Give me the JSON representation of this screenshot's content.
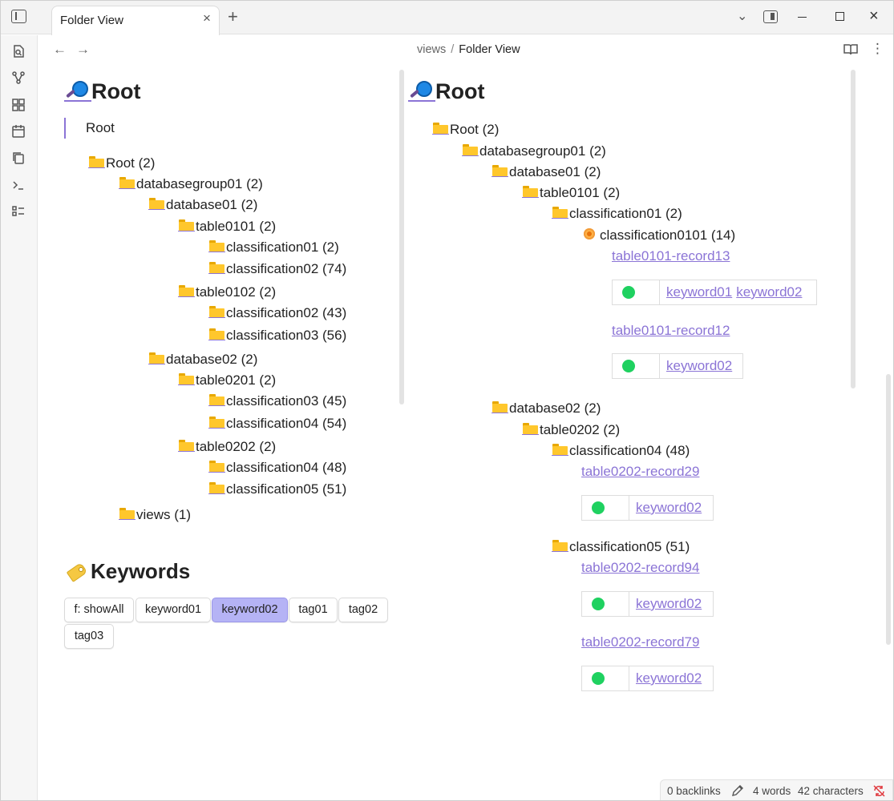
{
  "window": {
    "tab_title": "Folder View",
    "breadcrumb_parent": "views",
    "breadcrumb_sep": "/",
    "breadcrumb_current": "Folder View"
  },
  "left": {
    "heading": "Root",
    "blockquote": "Root",
    "tree": [
      {
        "label": "Root (2)"
      },
      {
        "label": "databasegroup01 (2)"
      },
      {
        "label": "database01 (2)"
      },
      {
        "label": "table0101 (2)"
      },
      {
        "label": "classification01 (2)"
      },
      {
        "label": "classification02 (74)"
      },
      {
        "label": "table0102 (2)"
      },
      {
        "label": "classification02 (43)"
      },
      {
        "label": "classification03 (56)"
      },
      {
        "label": "database02 (2)"
      },
      {
        "label": "table0201 (2)"
      },
      {
        "label": "classification03 (45)"
      },
      {
        "label": "classification04 (54)"
      },
      {
        "label": "table0202 (2)"
      },
      {
        "label": "classification04 (48)"
      },
      {
        "label": "classification05 (51)"
      },
      {
        "label": "views (1)"
      }
    ],
    "keywords_heading": "Keywords",
    "keyword_buttons": [
      "f: showAll",
      "keyword01",
      "keyword02",
      "tag01",
      "tag02",
      "tag03"
    ],
    "active_keyword": "keyword02"
  },
  "right": {
    "heading": "Root",
    "tree": [
      {
        "label": "Root (2)"
      },
      {
        "label": "databasegroup01 (2)"
      },
      {
        "label": "database01 (2)"
      },
      {
        "label": "table0101 (2)"
      },
      {
        "label": "classification01 (2)"
      },
      {
        "label": "classification0101 (14)"
      },
      {
        "label": "database02 (2)"
      },
      {
        "label": "table0202 (2)"
      },
      {
        "label": "classification04 (48)"
      },
      {
        "label": "classification05 (51)"
      }
    ],
    "records": [
      {
        "name": "table0101-record13",
        "keywords": [
          "keyword01",
          "keyword02"
        ]
      },
      {
        "name": "table0101-record12",
        "keywords": [
          "keyword02"
        ]
      },
      {
        "name": "table0202-record29",
        "keywords": [
          "keyword02"
        ]
      },
      {
        "name": "table0202-record94",
        "keywords": [
          "keyword02"
        ]
      },
      {
        "name": "table0202-record79",
        "keywords": [
          "keyword02"
        ]
      }
    ]
  },
  "status": {
    "backlinks": "0 backlinks",
    "words": "4 words",
    "characters": "42 characters"
  },
  "colors": {
    "accent": "#8b74d6",
    "active_button": "#b5b3f5",
    "status_dot": "#1fd160",
    "folder": "#ffc72c"
  }
}
